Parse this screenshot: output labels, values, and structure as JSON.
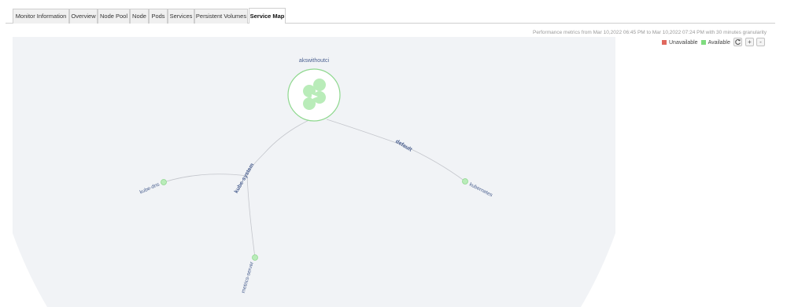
{
  "tabs": [
    {
      "label": "Monitor Information",
      "active": false
    },
    {
      "label": "Overview",
      "active": false
    },
    {
      "label": "Node Pool",
      "active": false
    },
    {
      "label": "Node",
      "active": false
    },
    {
      "label": "Pods",
      "active": false
    },
    {
      "label": "Services",
      "active": false
    },
    {
      "label": "Persistent Volumes",
      "active": false
    },
    {
      "label": "Service Map",
      "active": true
    }
  ],
  "performance_text": "Performance metrics from Mar 10,2022 06:45 PM to Mar 10,2022 07:24 PM with 30 minutes granularity",
  "legend": {
    "unavailable": {
      "label": "Unavailable",
      "color": "#e0685e"
    },
    "available": {
      "label": "Available",
      "color": "#7fdc7f"
    }
  },
  "controls": {
    "refresh_icon": "refresh-icon",
    "zoom_in": "+",
    "zoom_out": "-"
  },
  "map": {
    "cluster": {
      "label": "akswithoutci",
      "status": "available"
    },
    "namespaces": [
      {
        "label": "kube-system"
      },
      {
        "label": "default"
      }
    ],
    "services": [
      {
        "label": "kube-dns",
        "namespace": "kube-system",
        "status": "available"
      },
      {
        "label": "metrics-server",
        "namespace": "kube-system",
        "status": "available"
      },
      {
        "label": "kubernetes",
        "namespace": "default",
        "status": "available"
      }
    ],
    "colors": {
      "node_fill": "#b9ecb9",
      "node_stroke": "#8fd88f",
      "link": "#c4c6cc",
      "label": "#4a5f8f",
      "canvas": "#f1f3f6"
    }
  }
}
